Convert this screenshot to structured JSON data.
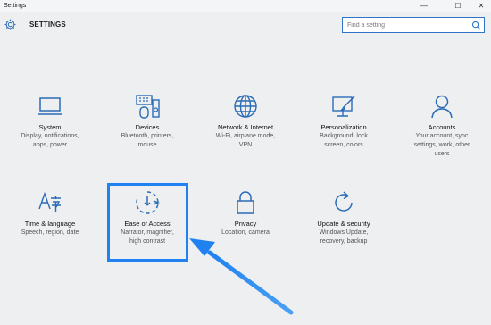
{
  "window": {
    "title": "Settings",
    "minimize": "—",
    "maximize": "☐",
    "close": "✕"
  },
  "header": {
    "title": "SETTINGS"
  },
  "search": {
    "placeholder": "Find a setting"
  },
  "tiles": [
    {
      "name": "System",
      "desc": [
        "Display, notifications,",
        "apps, power"
      ]
    },
    {
      "name": "Devices",
      "desc": [
        "Bluetooth, printers,",
        "mouse"
      ]
    },
    {
      "name": "Network & Internet",
      "desc": [
        "Wi-Fi, airplane mode,",
        "VPN"
      ]
    },
    {
      "name": "Personalization",
      "desc": [
        "Background, lock",
        "screen, colors"
      ]
    },
    {
      "name": "Accounts",
      "desc": [
        "Your account, sync",
        "settings, work, other",
        "users"
      ]
    },
    {
      "name": "Time & language",
      "desc": [
        "Speech, region, date"
      ]
    },
    {
      "name": "Ease of Access",
      "desc": [
        "Narrator, magnifier,",
        "high contrast"
      ]
    },
    {
      "name": "Privacy",
      "desc": [
        "Location, camera"
      ]
    },
    {
      "name": "Update & security",
      "desc": [
        "Windows Update,",
        "recovery, backup"
      ]
    }
  ],
  "colors": {
    "accent": "#2e74c8",
    "icon": "#2b6cb6",
    "highlight": "#1f82f0"
  }
}
